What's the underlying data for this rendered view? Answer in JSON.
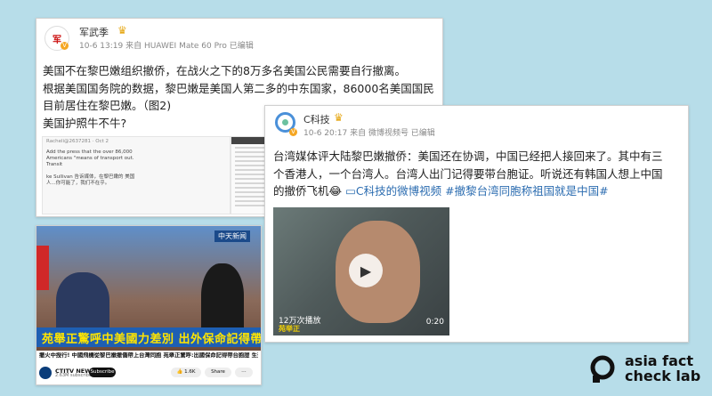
{
  "post1": {
    "author": "军武季",
    "avatar_text": "军",
    "meta": "10-6 13:19 来自 HUAWEI Mate 60 Pro 已编辑",
    "lines": [
      "美国不在黎巴嫩组织撤侨，在战火之下的8万多名美国公民需要自行撤离。",
      "根据美国国务院的数据，黎巴嫩是美国人第二多的中东国家，86000名美国国民",
      "目前居住在黎巴嫩。（图2)",
      "美国护照牛不牛?"
    ],
    "screenshot_meta": "Racheli@2637281 · Oct 2",
    "screenshot_text": "Add the press that the over 86,000 Americans \"means of transport out. Transit",
    "screenshot_text2": "ke Sullivan 告诉媒体，在黎巴嫩的 美国人...你可能了，我们不在乎。"
  },
  "post2": {
    "author": "C科技",
    "meta": "10-6 20:17 来自 微博视频号 已编辑",
    "lines": [
      "台湾媒体评大陆黎巴嫩撤侨：美国还在协调，中国已经把人接回来了。其中有三",
      "个香港人，一个台湾人。台湾人出门记得要带台胞证。听说还有韩国人想上中国",
      "的撤侨飞机"
    ],
    "emoji": "😂",
    "link_icon": "video-link-icon",
    "link_text": "C科技的微博视频",
    "hashtag": "#撤黎台湾同胞称祖国就是中国#",
    "video": {
      "views": "12万次播放",
      "duration": "0:20",
      "subtitle": "苑举正"
    }
  },
  "post3": {
    "tv_logo": "中天新闻",
    "banner": "苑舉正驚呼中美國力差別 出外保命記得帶台胞證",
    "caption": "撤火中授行! 中國飛機從黎巴嫩撤僑帶上台灣同胞 苑舉正驚呼:出國保命記得帶台胞證 生死交關看出邊境",
    "channel_name": "CTITV NEWS 中",
    "channel_subs": "2.63M subscribers",
    "subscribe": "Subscribe",
    "likes": "1.6K",
    "share": "Share"
  },
  "brand": {
    "line1": "asia fact",
    "line2": "check lab"
  },
  "colors": {
    "background": "#b7dde9",
    "link": "#2b6cb0",
    "banner_text": "#ffe500"
  }
}
